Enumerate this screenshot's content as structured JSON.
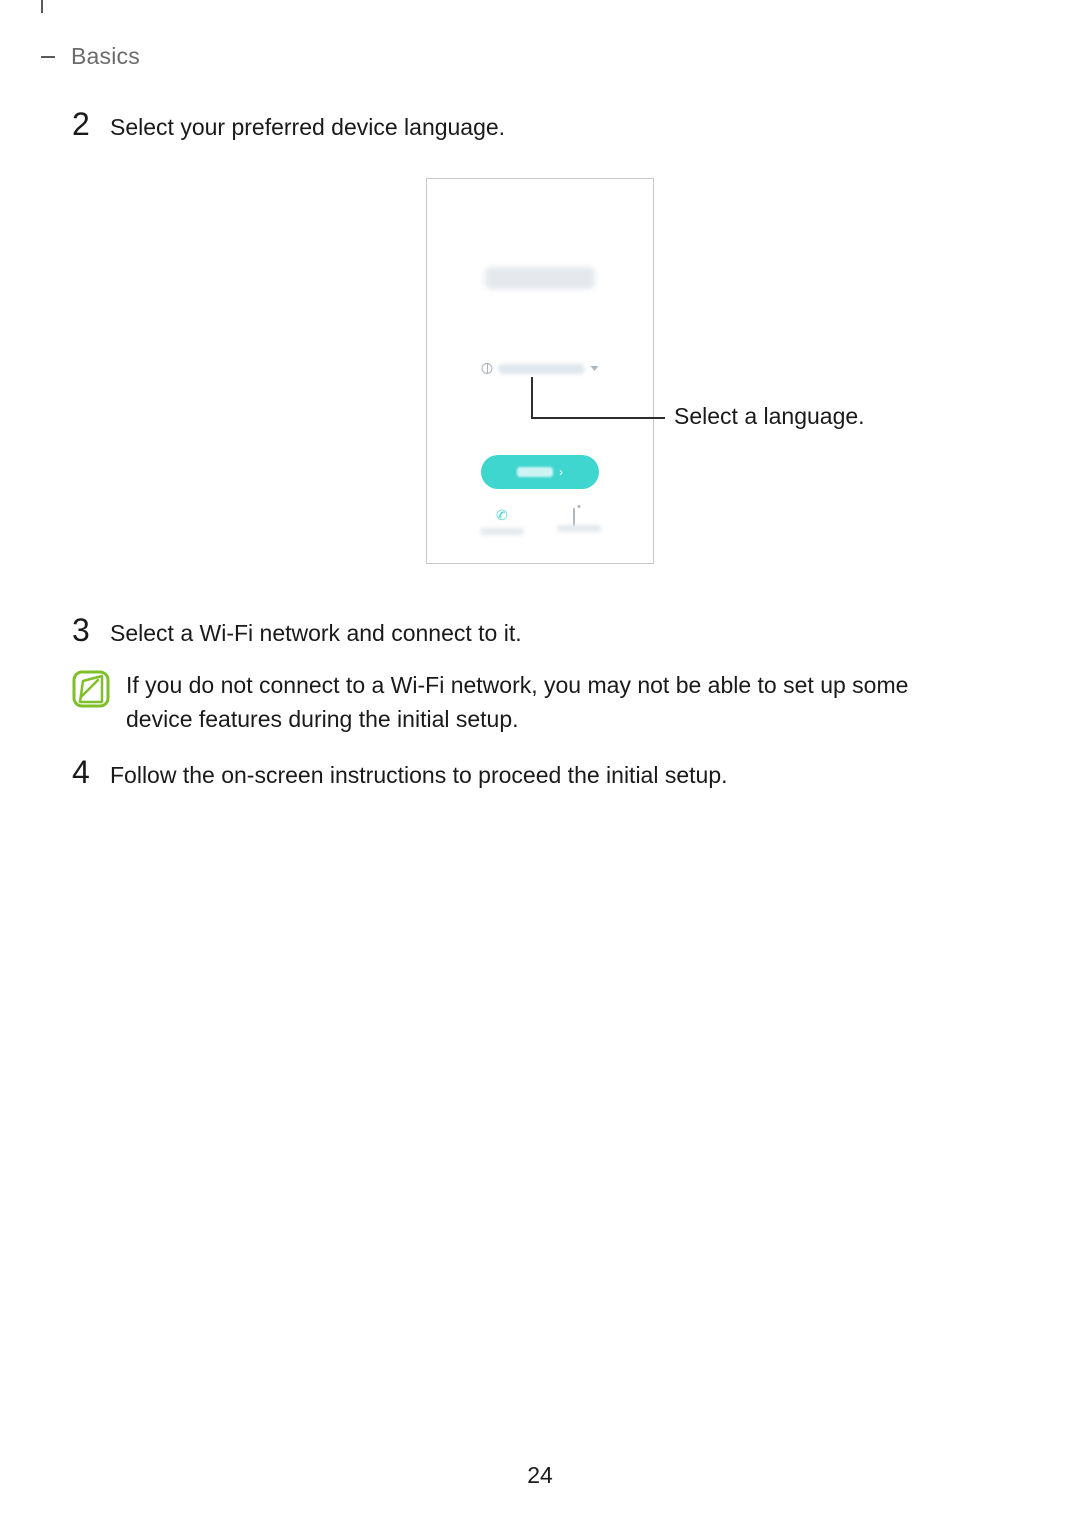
{
  "header": {
    "section": "Basics"
  },
  "steps": {
    "s2": {
      "num": "2",
      "text": "Select your preferred device language."
    },
    "s3": {
      "num": "3",
      "text": "Select a Wi-Fi network and connect to it."
    },
    "s4": {
      "num": "4",
      "text": "Follow the on-screen instructions to proceed the initial setup."
    }
  },
  "callout": {
    "text": "Select a language."
  },
  "note": {
    "text": "If you do not connect to a Wi-Fi network, you may not be able to set up some device features during the initial setup."
  },
  "page_number": "24"
}
